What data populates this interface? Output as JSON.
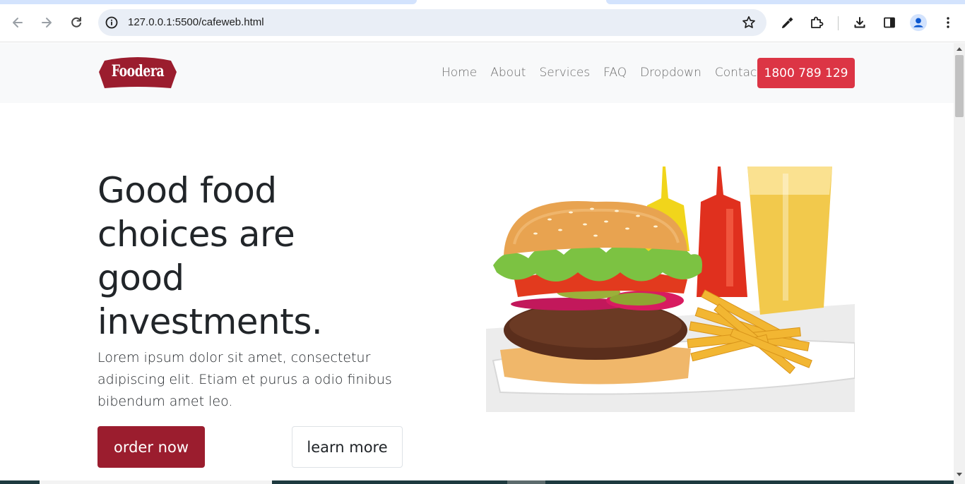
{
  "browser": {
    "url": "127.0.0.1:5500/cafeweb.html"
  },
  "site": {
    "logo_text": "Foodera",
    "nav": [
      "Home",
      "About",
      "Services",
      "FAQ",
      "Dropdown",
      "Contact"
    ],
    "phone_label": "1800 789 129",
    "brand_color": "#9b1d2e",
    "accent_color": "#dc3545"
  },
  "hero": {
    "title_lines": [
      "Good food",
      "choices are",
      "good",
      "investments."
    ],
    "text": "Lorem ipsum dolor sit amet, consectetur adipiscing elit. Etiam et purus a odio finibus bibendum amet leo.",
    "order_label": "order now",
    "learn_label": "learn more",
    "image_alt": "burger-with-fries-and-drink"
  }
}
